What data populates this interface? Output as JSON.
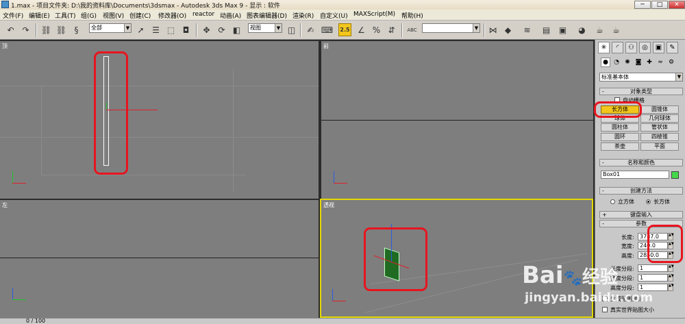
{
  "window": {
    "title": "1.max    - 项目文件夹: D:\\我的资料库\\Documents\\3dsmax    - Autodesk 3ds Max 9    - 显示 : 软件"
  },
  "menu": [
    "文件(F)",
    "编辑(E)",
    "工具(T)",
    "组(G)",
    "视图(V)",
    "创建(C)",
    "修改器(O)",
    "reactor",
    "动画(A)",
    "图表编辑器(D)",
    "渲染(R)",
    "自定义(U)",
    "MAXScript(M)",
    "帮助(H)"
  ],
  "toolbar": {
    "selection_filter": "全部",
    "ref_coord": "视图",
    "snap_label": "2.5",
    "named_selection": ""
  },
  "viewports": {
    "top": "顶",
    "front": "前",
    "left": "左",
    "perspective": "透视"
  },
  "panel": {
    "category_dropdown": "标准基本体",
    "object_type": {
      "title": "对象类型",
      "autogrid_label": "自动栅格",
      "buttons": [
        "长方体",
        "圆锥体",
        "球体",
        "几何球体",
        "圆柱体",
        "管状体",
        "圆环",
        "四棱锥",
        "茶壶",
        "平面"
      ]
    },
    "name_color": {
      "title": "名称和颜色",
      "name": "Box01",
      "color": "#43d94a"
    },
    "creation_method": {
      "title": "创建方法",
      "options": [
        "立方体",
        "长方体"
      ],
      "selected": "长方体"
    },
    "keyboard_entry": {
      "title": "键盘输入"
    },
    "parameters": {
      "title": "参数",
      "length_label": "长度:",
      "length": "3787.0",
      "width_label": "宽度:",
      "width": "240.0",
      "height_label": "高度:",
      "height": "2850.0",
      "length_segs_label": "长度分段:",
      "length_segs": "1",
      "width_segs_label": "宽度分段:",
      "width_segs": "1",
      "height_segs_label": "高度分段:",
      "height_segs": "1",
      "gen_mapping_label": "生成贴图坐标",
      "real_world_label": "真实世界贴图大小"
    }
  },
  "status": {
    "frame": "0 / 100"
  },
  "watermark": {
    "brand": "Bai",
    "brand2": "经验",
    "url": "jingyan.baidu.com"
  },
  "colors": {
    "highlight_yellow": "#f3c61d",
    "annotation_red": "#e8141e",
    "active_viewport_border": "#e3d900"
  }
}
